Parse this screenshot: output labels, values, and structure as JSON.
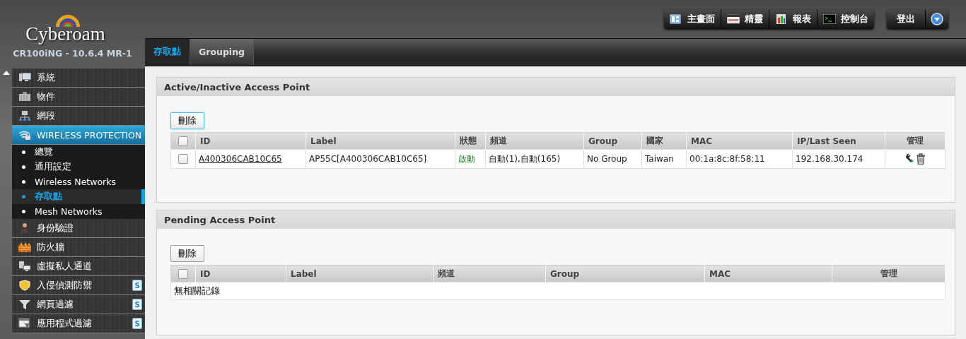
{
  "brand": {
    "name": "Cyberoam",
    "version": "CR100iNG - 10.6.4 MR-1"
  },
  "header_buttons": [
    "主畫面",
    "精靈",
    "報表",
    "控制台"
  ],
  "logout": {
    "label": "登出"
  },
  "tabs": [
    {
      "label": "存取點",
      "selected": true
    },
    {
      "label": "Grouping",
      "selected": false
    }
  ],
  "sidebar": {
    "items": [
      {
        "label": "系統",
        "expanded": false
      },
      {
        "label": "物件",
        "expanded": false
      },
      {
        "label": "網段",
        "expanded": false
      },
      {
        "label": "WIRELESS PROTECTION",
        "expanded": true,
        "children": [
          {
            "label": "總覽",
            "selected": false
          },
          {
            "label": "通用設定",
            "selected": false
          },
          {
            "label": "Wireless Networks",
            "selected": false
          },
          {
            "label": "存取點",
            "selected": true
          },
          {
            "label": "Mesh Networks",
            "selected": false
          }
        ]
      },
      {
        "label": "身份驗證",
        "expanded": false
      },
      {
        "label": "防火牆",
        "expanded": false
      },
      {
        "label": "虛擬私人通道",
        "expanded": false
      },
      {
        "label": "入侵偵測防禦",
        "expanded": false,
        "badge": "S"
      },
      {
        "label": "網頁過濾",
        "expanded": false,
        "badge": "S"
      },
      {
        "label": "應用程式過濾",
        "expanded": false,
        "badge": "S"
      }
    ]
  },
  "panels": [
    {
      "title": "Active/Inactive Access Point",
      "delete_button": "刪除",
      "columns": [
        "ID",
        "Label",
        "狀態",
        "頻道",
        "Group",
        "國家",
        "MAC",
        "IP/Last Seen",
        "管理"
      ],
      "select_all_checked": false,
      "rows": [
        {
          "checked": false,
          "cells": [
            {
              "kind": "link",
              "text": "A400306CAB10C65"
            },
            {
              "kind": "text",
              "text": "AP55C[A400306CAB10C65]"
            },
            {
              "kind": "status",
              "text": "啟動"
            },
            {
              "kind": "text",
              "text": "自動(1),自動(165)"
            },
            {
              "kind": "text",
              "text": "No Group"
            },
            {
              "kind": "text",
              "text": "Taiwan"
            },
            {
              "kind": "text",
              "text": "00:1a:8c:8f:58:11"
            },
            {
              "kind": "text",
              "text": "192.168.30.174"
            },
            {
              "kind": "actions"
            }
          ]
        }
      ]
    },
    {
      "title": "Pending Access Point",
      "delete_button": "刪除",
      "columns": [
        "ID",
        "Label",
        "頻道",
        "Group",
        "MAC",
        "管理"
      ],
      "select_all_checked": false,
      "empty_message": "無相關記錄"
    }
  ]
}
